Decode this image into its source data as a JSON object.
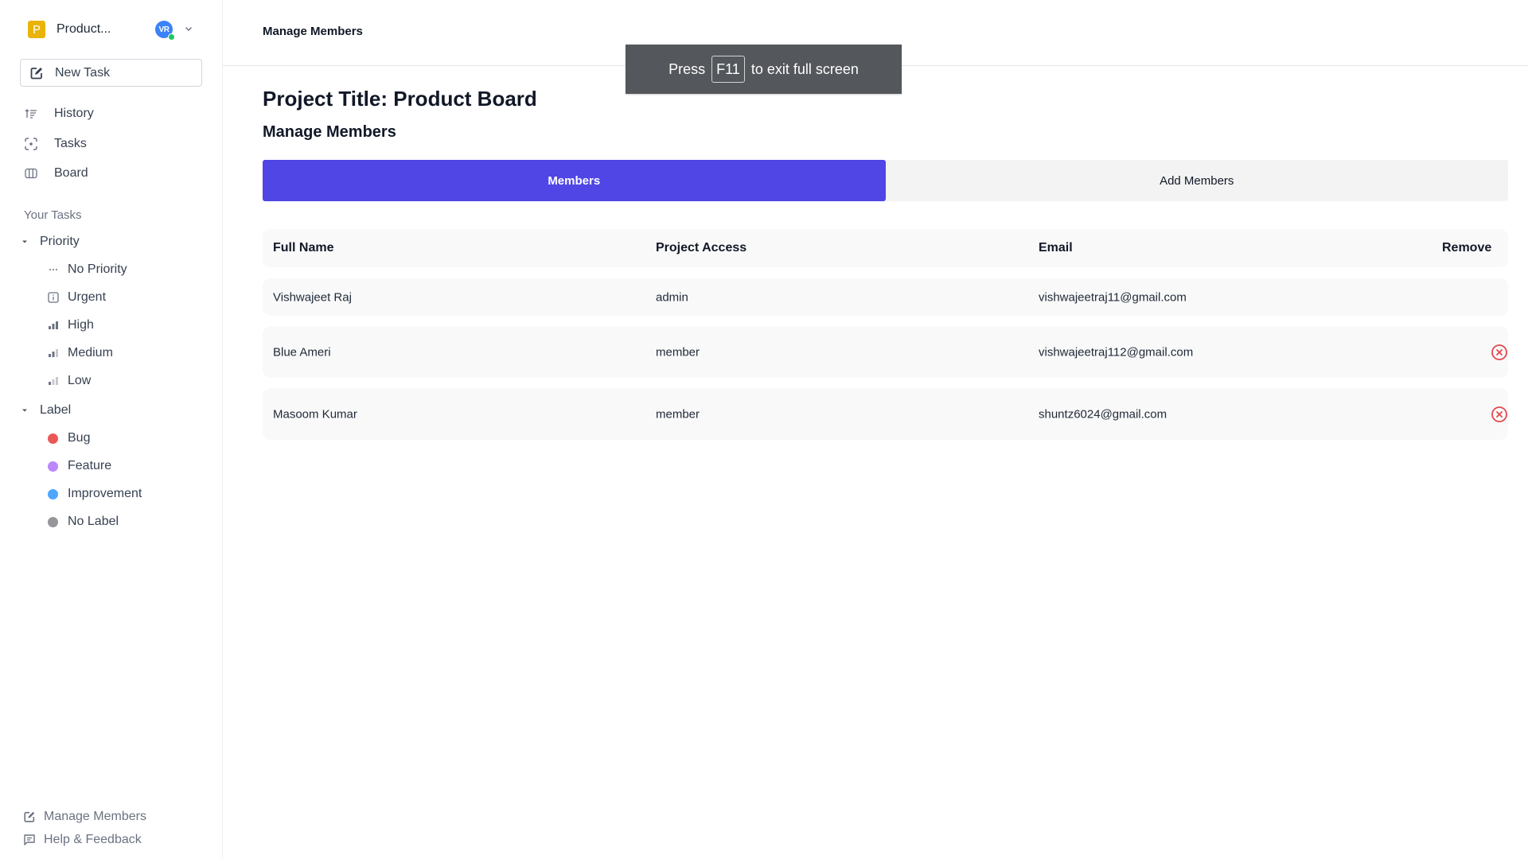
{
  "sidebar": {
    "workspace": {
      "initial": "P",
      "name": "Product...",
      "logo_color": "#eab308"
    },
    "user": {
      "initials": "VR",
      "avatar_color": "#3b82f6",
      "status_color": "#22c55e",
      "menu_icon": "chevron-down-icon"
    },
    "new_task_label": "New Task",
    "nav": [
      {
        "label": "History",
        "icon": "history-sort-icon"
      },
      {
        "label": "Tasks",
        "icon": "focus-tasks-icon"
      },
      {
        "label": "Board",
        "icon": "board-columns-icon"
      }
    ],
    "section_title": "Your Tasks",
    "priority_group": {
      "label": "Priority",
      "items": [
        {
          "label": "No Priority",
          "icon": "dots-icon"
        },
        {
          "label": "Urgent",
          "icon": "urgent-box-icon"
        },
        {
          "label": "High",
          "icon": "signal-high-icon"
        },
        {
          "label": "Medium",
          "icon": "signal-medium-icon"
        },
        {
          "label": "Low",
          "icon": "signal-low-icon"
        }
      ]
    },
    "label_group": {
      "label": "Label",
      "items": [
        {
          "label": "Bug",
          "color": "#eb5757"
        },
        {
          "label": "Feature",
          "color": "#bb87fc"
        },
        {
          "label": "Improvement",
          "color": "#4ea7fc"
        },
        {
          "label": "No Label",
          "color": "#95959a"
        }
      ]
    },
    "footer": [
      {
        "label": "Manage Members",
        "icon": "edit-icon"
      },
      {
        "label": "Help & Feedback",
        "icon": "message-icon"
      }
    ]
  },
  "main": {
    "header_title": "Manage Members",
    "page_title": "Project Title: Product Board",
    "page_subtitle": "Manage Members",
    "accent_color": "#4f46e5",
    "tabs": [
      {
        "label": "Members",
        "active": true
      },
      {
        "label": "Add Members",
        "active": false
      }
    ],
    "table": {
      "columns": [
        "Full Name",
        "Project Access",
        "Email",
        "Remove"
      ],
      "rows": [
        {
          "name": "Vishwajeet Raj",
          "access": "admin",
          "email": "vishwajeetraj11@gmail.com",
          "removable": false
        },
        {
          "name": "Blue Ameri",
          "access": "member",
          "email": "vishwajeetraj112@gmail.com",
          "removable": true
        },
        {
          "name": "Masoom Kumar",
          "access": "member",
          "email": "shuntz6024@gmail.com",
          "removable": true
        }
      ]
    }
  },
  "fullscreen_toast": {
    "prefix": "Press",
    "key": "F11",
    "suffix": "to exit full screen"
  }
}
